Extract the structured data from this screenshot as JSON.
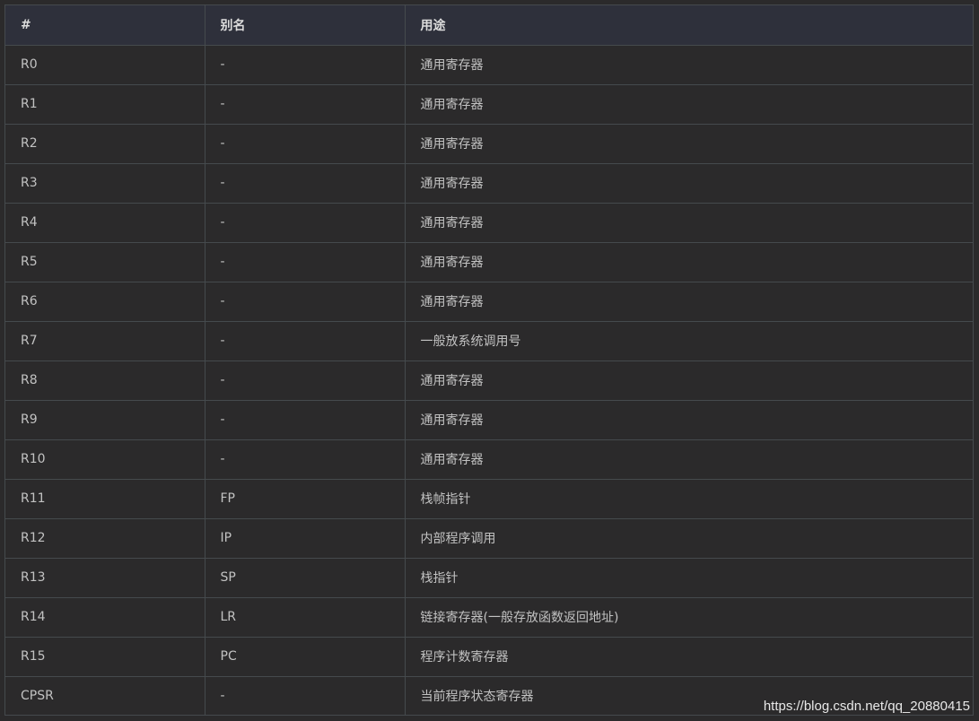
{
  "table": {
    "headers": [
      "#",
      "别名",
      "用途"
    ],
    "rows": [
      [
        "R0",
        "-",
        "通用寄存器"
      ],
      [
        "R1",
        "-",
        "通用寄存器"
      ],
      [
        "R2",
        "-",
        "通用寄存器"
      ],
      [
        "R3",
        "-",
        "通用寄存器"
      ],
      [
        "R4",
        "-",
        "通用寄存器"
      ],
      [
        "R5",
        "-",
        "通用寄存器"
      ],
      [
        "R6",
        "-",
        "通用寄存器"
      ],
      [
        "R7",
        "-",
        "一般放系统调用号"
      ],
      [
        "R8",
        "-",
        "通用寄存器"
      ],
      [
        "R9",
        "-",
        "通用寄存器"
      ],
      [
        "R10",
        "-",
        "通用寄存器"
      ],
      [
        "R11",
        "FP",
        "栈帧指针"
      ],
      [
        "R12",
        "IP",
        "内部程序调用"
      ],
      [
        "R13",
        "SP",
        "栈指针"
      ],
      [
        "R14",
        "LR",
        "链接寄存器(一般存放函数返回地址)"
      ],
      [
        "R15",
        "PC",
        "程序计数寄存器"
      ],
      [
        "CPSR",
        "-",
        "当前程序状态寄存器"
      ]
    ]
  },
  "watermark": "https://blog.csdn.net/qq_20880415",
  "colors": {
    "background": "#2b2a2b",
    "header_background": "#2e303b",
    "border": "#454a4d",
    "text": "#c2c2c2",
    "header_text": "#dcdcdc"
  }
}
